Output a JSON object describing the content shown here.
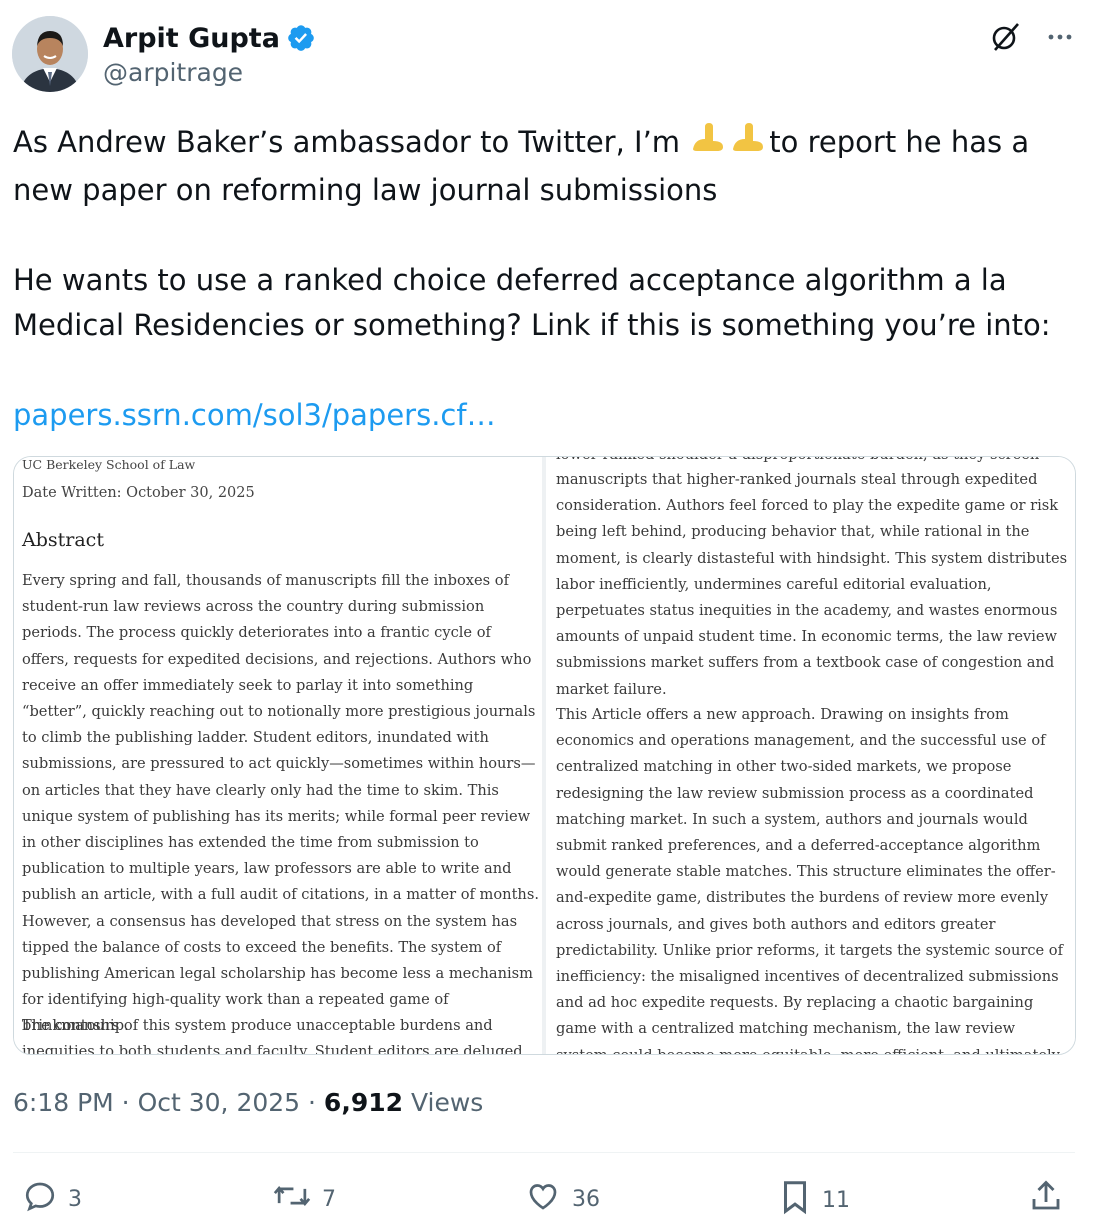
{
  "user": {
    "name": "Arpit Gupta",
    "handle": "@arpitrage",
    "verified_color": "#1d9bf0"
  },
  "tweet": {
    "line1_a": "As Andrew Baker’s ambassador to Twitter, I’m ",
    "emoji": "foot-emoji",
    "line1_b": "to report he has a new paper on reforming law journal submissions",
    "para2": "He wants to use a ranked choice deferred acceptance algorithm a la Medical Residencies or something? Link if this is something you’re into:",
    "link": "papers.ssrn.com/sol3/papers.cf…"
  },
  "media": {
    "left": {
      "institution": "UC Berkeley School of Law",
      "date_written": "Date Written: October 30, 2025",
      "heading": "Abstract",
      "para1": "Every spring and fall, thousands of manuscripts fill the inboxes of student-run law reviews across the country during submission periods. The process quickly deteriorates into a frantic cycle of offers, requests for expedited decisions, and rejections. Authors who receive an offer immediately seek to parlay it into something “better”, quickly reaching out to notionally more prestigious journals to climb the publishing ladder. Student editors, inundated with submissions, are pressured to act quickly—sometimes within hours—on articles that they have clearly only had the time to skim. This unique system of publishing has its merits; while formal peer review in other disciplines has extended the time from submission to publication to multiple years, law professors are able to write and publish an article, with a full audit of citations, in a matter of months. However, a consensus has developed that stress on the system has tipped the balance of costs to exceed the benefits. The system of publishing American legal scholarship has become less a mechanism for identifying high-quality work than a repeated game of brinkmanship.",
      "para2": "The contours of this system produce unacceptable burdens and inequities to both students and faculty. Student editors are deluged with submissions"
    },
    "right": {
      "cut_line": "lower-ranked shoulder a disproportionate burden, as they screen",
      "para1": "manuscripts that higher-ranked journals steal through expedited consideration. Authors feel forced to play the expedite game or risk being left behind, producing behavior that, while rational in the moment, is clearly distasteful with hindsight. This system distributes labor inefficiently, undermines careful editorial evaluation, perpetuates status inequities in the academy, and wastes enormous amounts of unpaid student time. In economic terms, the law review submissions market suffers from a textbook case of congestion and market failure.",
      "para2": "This Article offers a new approach. Drawing on insights from economics and operations management, and the successful use of centralized matching in other two-sided markets, we propose redesigning the law review submission process as a coordinated matching market. In such a system, authors and journals would submit ranked preferences, and a deferred-acceptance algorithm would generate stable matches. This structure eliminates the offer-and-expedite game, distributes the burdens of review more evenly across journals, and gives both authors and editors greater predictability. Unlike prior reforms, it targets the systemic source of inefficiency: the misaligned incentives of decentralized submissions and ad hoc expedite requests. By replacing a chaotic bargaining game with a centralized matching mechanism, the law review system could become more equitable, more efficient, and ultimately more conducive to high-quality scholarship."
    }
  },
  "meta": {
    "time": "6:18 PM",
    "sep": " · ",
    "date": "Oct 30, 2025",
    "views_count": "6,912",
    "views_label": " Views"
  },
  "actions": {
    "replies": "3",
    "reposts": "7",
    "likes": "36",
    "bookmarks": "11"
  },
  "icons": [
    "grok-icon",
    "more-icon",
    "reply-icon",
    "repost-icon",
    "like-icon",
    "bookmark-icon",
    "share-icon",
    "verified-badge-icon"
  ]
}
